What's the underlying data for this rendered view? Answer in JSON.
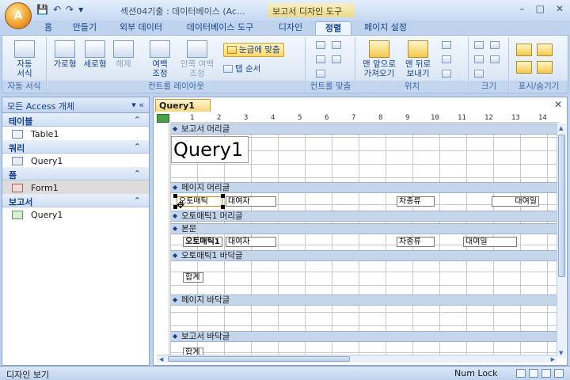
{
  "window": {
    "title": "섹션04기출 : 데이터베이스 (Ac...",
    "context_tab_title": "보고서 디자인 도구",
    "office_button_glyph": "A",
    "qat": {
      "save": "💾",
      "undo": "↶",
      "redo": "↷",
      "customize": "▾"
    },
    "controls": {
      "minimize": "–",
      "maximize": "□",
      "close": "✕"
    }
  },
  "ribbon_tabs": [
    "홈",
    "만들기",
    "외부 데이터",
    "데이터베이스 도구",
    "디자인",
    "정렬",
    "페이지 설정"
  ],
  "active_tab": "정렬",
  "ribbon": {
    "groups": {
      "autoformat": "자동 서식",
      "control_layout": "컨트롤 레이아웃",
      "control_align": "컨트롤 맞춤",
      "position": "위치",
      "size": "크기",
      "show_hide": "표시/숨기기"
    },
    "buttons": {
      "autoformat_line1": "자동",
      "autoformat_line2": "서식",
      "tabular": "가로형",
      "stacked": "세로형",
      "remove": "해제",
      "margins_line1": "여백",
      "margins_line2": "조정",
      "padding_line1": "안쪽 여백",
      "padding_line2": "조정",
      "snap_to_grid": "눈금에 맞춤",
      "tab_order": "탭 순서",
      "bring_front_line1": "맨 앞으로",
      "bring_front_line2": "가져오기",
      "send_back_line1": "맨 뒤로",
      "send_back_line2": "보내기"
    }
  },
  "nav": {
    "header": "모든 Access 개체",
    "header_controls": "▾  «",
    "collapse": "⌃",
    "groups": [
      {
        "label": "테이블",
        "items": [
          "Table1"
        ]
      },
      {
        "label": "쿼리",
        "items": [
          "Query1"
        ]
      },
      {
        "label": "폼",
        "items": [
          "Form1"
        ]
      },
      {
        "label": "보고서",
        "items": [
          "Query1"
        ]
      }
    ]
  },
  "document": {
    "tab_label": "Query1",
    "close": "✕",
    "ruler": [
      "1",
      "2",
      "3",
      "4",
      "5",
      "6",
      "7",
      "8",
      "9",
      "10",
      "11",
      "12",
      "13",
      "14"
    ],
    "sections": {
      "report_header": "보고서 머리글",
      "page_header": "페이지 머리글",
      "group_header": "오토매틱1 머리글",
      "detail": "본문",
      "group_footer": "오토매틱1 바닥글",
      "page_footer": "페이지 바닥글",
      "report_footer": "보고서 바닥글"
    },
    "report_title": "Query1",
    "page_header_controls": [
      "오토매틱",
      "대여자",
      "차종류",
      "대여일"
    ],
    "detail_controls": [
      "오토매틱1",
      "대여자",
      "차종류",
      "대여일"
    ],
    "footer_total": "합계",
    "report_footer_control": "합계"
  },
  "status": {
    "left": "디자인 보기",
    "right": "Num Lock"
  }
}
